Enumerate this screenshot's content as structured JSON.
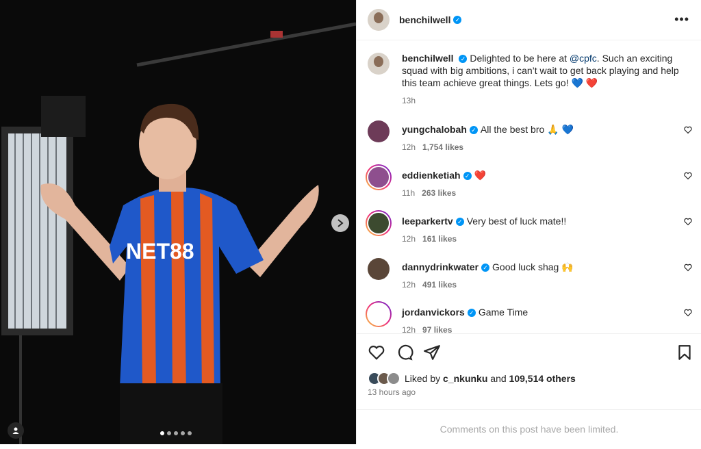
{
  "post": {
    "author": "benchilwell",
    "caption_prefix": "Delighted to be here at ",
    "mention": "@cpfc",
    "caption_suffix": ". Such an exciting squad with big ambitions, i can’t wait to get back playing and help this team achieve great things. Lets go! 💙 ❤️",
    "time": "13h",
    "photo_shirt_text": "NET88",
    "carousel_count": 5,
    "carousel_active": 1
  },
  "comments": [
    {
      "user": "yungchalobah",
      "text": "All the best bro 🙏 💙",
      "time": "12h",
      "likes": "1,754 likes",
      "avatar_color": "#6d3b58",
      "story": false
    },
    {
      "user": "eddienketiah",
      "text": "❤️",
      "time": "11h",
      "likes": "263 likes",
      "avatar_color": "#8e4f8e",
      "story": true
    },
    {
      "user": "leeparkertv",
      "text": "Very best of luck mate!!",
      "time": "12h",
      "likes": "161 likes",
      "avatar_color": "#3c4a2f",
      "story": true
    },
    {
      "user": "dannydrinkwater",
      "text": "Good luck shag 🙌",
      "time": "12h",
      "likes": "491 likes",
      "avatar_color": "#5a4638",
      "story": false
    },
    {
      "user": "jordanvickors",
      "text": "Game Time",
      "time": "12h",
      "likes": "97 likes",
      "avatar_color": "#ffffff",
      "story": true
    }
  ],
  "likes": {
    "prefix": "Liked by ",
    "liker": "c_nkunku",
    "middle": " and ",
    "count": "109,514 others"
  },
  "post_age": "13 hours ago",
  "limited_text": "Comments on this post have been limited.",
  "colors": {
    "verified": "#0095f6",
    "heart": "#ed4956",
    "link": "#00376b"
  }
}
